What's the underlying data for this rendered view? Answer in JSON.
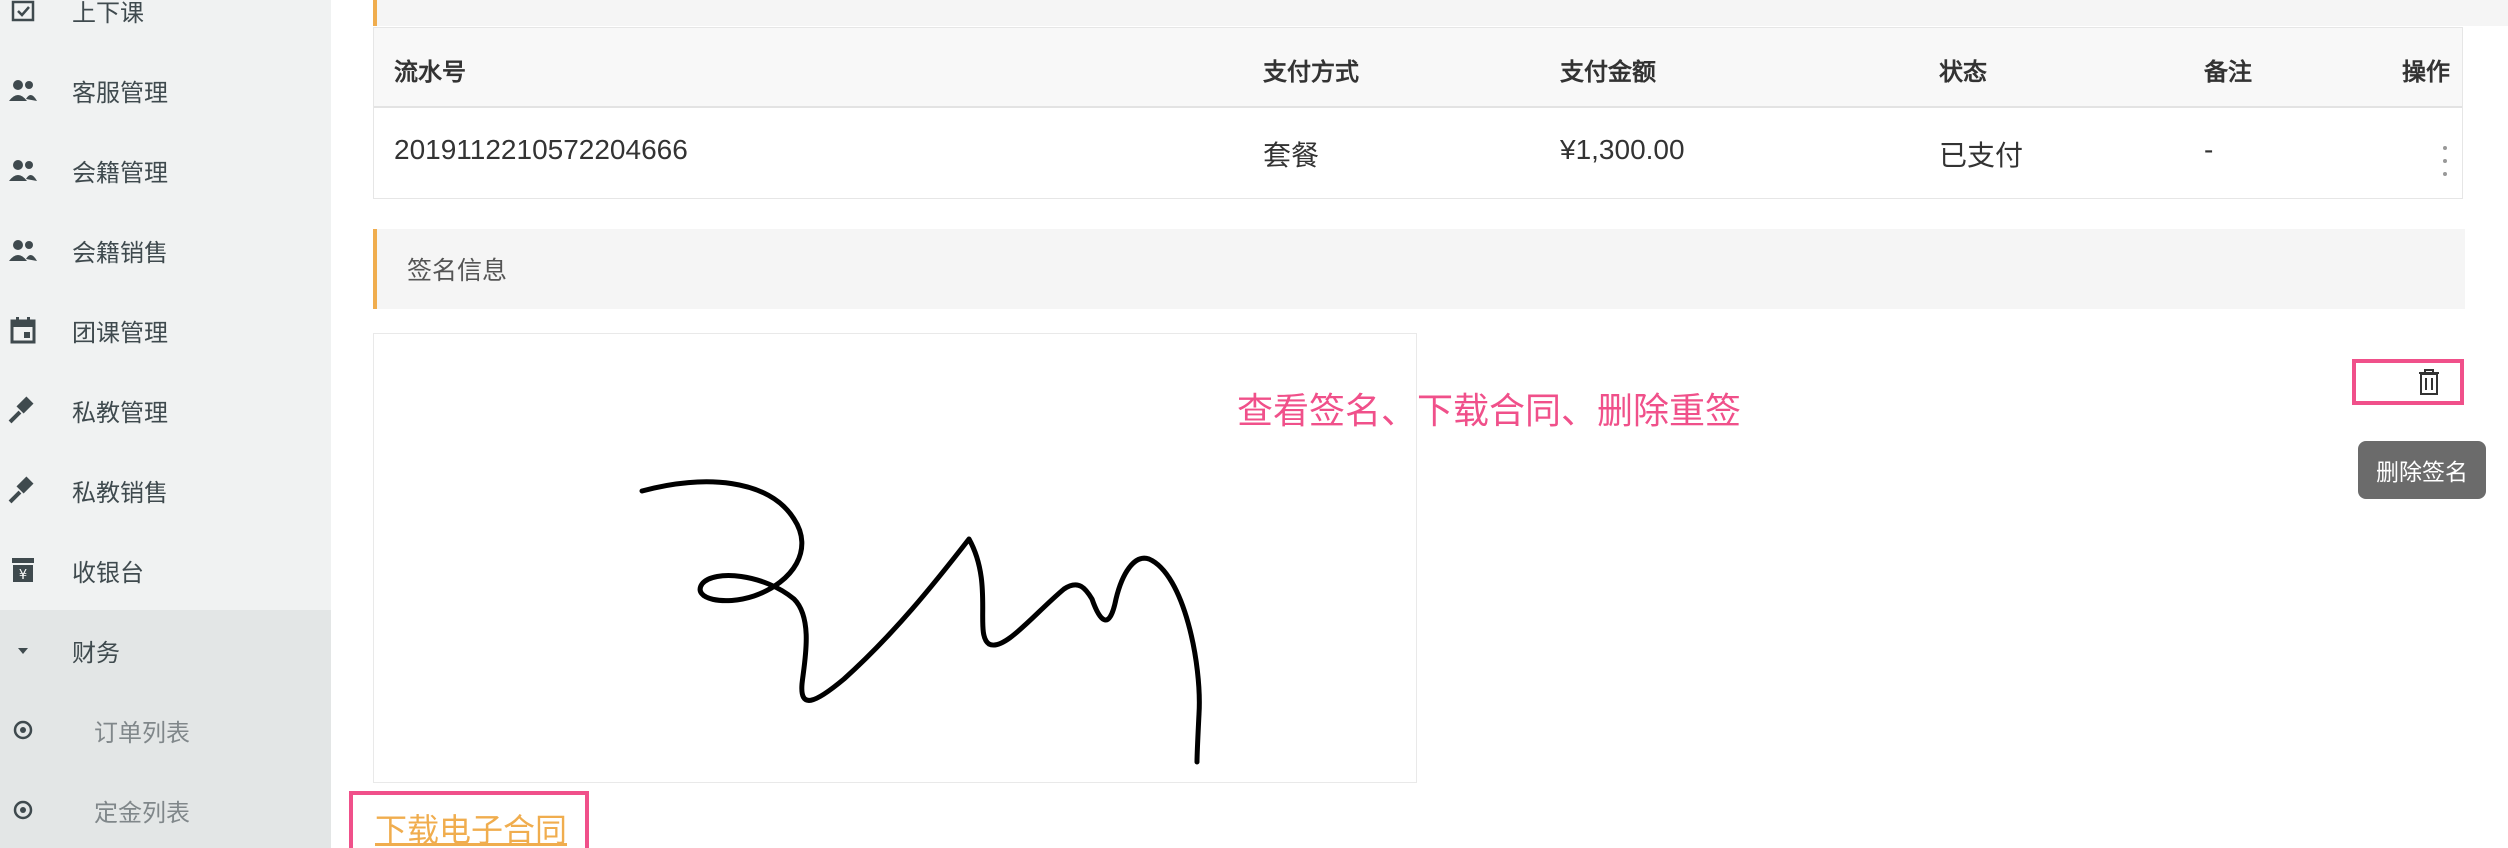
{
  "sidebar": {
    "items": [
      {
        "label": "上下课",
        "icon": "calendar-check-icon"
      },
      {
        "label": "客服管理",
        "icon": "people-icon"
      },
      {
        "label": "会籍管理",
        "icon": "people-icon"
      },
      {
        "label": "会籍销售",
        "icon": "people-icon"
      },
      {
        "label": "团课管理",
        "icon": "calendar-icon"
      },
      {
        "label": "私教管理",
        "icon": "hammer-icon"
      },
      {
        "label": "私教销售",
        "icon": "hammer-icon"
      },
      {
        "label": "收银台",
        "icon": "cashier-icon"
      },
      {
        "label": "财务",
        "icon": "caret-down-icon"
      },
      {
        "label": "订单列表",
        "icon": "radio-icon"
      },
      {
        "label": "定金列表",
        "icon": "radio-icon"
      }
    ]
  },
  "payment_table": {
    "headers": {
      "serial": "流水号",
      "method": "支付方式",
      "amount": "支付金额",
      "status": "状态",
      "note": "备注",
      "action": "操作"
    },
    "rows": [
      {
        "serial": "2019112210572204666",
        "method": "套餐",
        "amount": "¥1,300.00",
        "status": "已支付",
        "note": "-"
      }
    ]
  },
  "signature_section": {
    "title": "签名信息"
  },
  "annotations": {
    "top": "查看签名、下载合同、删除重签"
  },
  "delete_tooltip": "删除签名",
  "download_link": "下载电子合同",
  "colors": {
    "accent_orange": "#f0ad4e",
    "annotation_pink": "#f0508a",
    "sidebar_bg": "#f0f2f2"
  }
}
